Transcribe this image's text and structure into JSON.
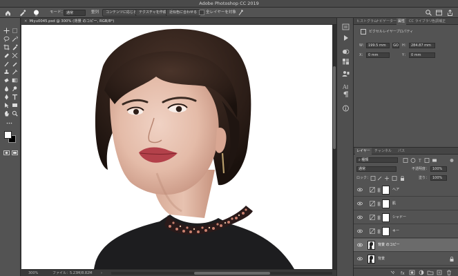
{
  "app": {
    "title": "Adobe Photoshop CC 2019"
  },
  "options": {
    "mode_label": "モード：",
    "mode_value": "通常",
    "opacity_label": "整列",
    "content_aware": "コンテンツに応じる",
    "texture": "テクスチャを作成",
    "approximate": "近似色に合わせる",
    "all_layers": "全レイヤーを対象"
  },
  "document": {
    "tab_label": "Miyu0045.psd @ 300% (背景 のコピー, RGB/8*)",
    "zoom": "300%",
    "file_info": "ファイル：5.23M/8.82M"
  },
  "properties": {
    "tabs": [
      "ヒストグラム",
      "ナビゲーター",
      "属性",
      "CC ライブラリ",
      "色調補正"
    ],
    "active_tab_index": 2,
    "section_title": "ピクセルレイヤープロパティ",
    "w_label": "W：",
    "w_value": "199.5 mm",
    "h_label": "H：",
    "h_value": "284.87 mm",
    "x_label": "X：",
    "x_value": "0 mm",
    "y_label": "Y：",
    "y_value": "0 mm",
    "link_symbol": "GO"
  },
  "layers_panel": {
    "tabs": [
      "レイヤー",
      "チャンネル",
      "パス"
    ],
    "kind_label": "種類",
    "blend_mode": "通常",
    "opacity_label": "不透明度：",
    "opacity_value": "100%",
    "lock_label": "ロック：",
    "fill_label": "塗り：",
    "fill_value": "100%",
    "layers": [
      {
        "name": "ヘア"
      },
      {
        "name": "肌"
      },
      {
        "name": "シャドー"
      },
      {
        "name": "キー"
      },
      {
        "name": "背景 のコピー"
      },
      {
        "name": "背景"
      }
    ],
    "bottom_icons": [
      "link-icon",
      "fx-icon",
      "mask-icon",
      "adjustment-icon",
      "folder-icon",
      "new-layer-icon",
      "trash-icon"
    ]
  },
  "colors": {
    "panel": "#535353",
    "canvas_bg": "#ffffff",
    "dark": "#2b2b2b"
  }
}
